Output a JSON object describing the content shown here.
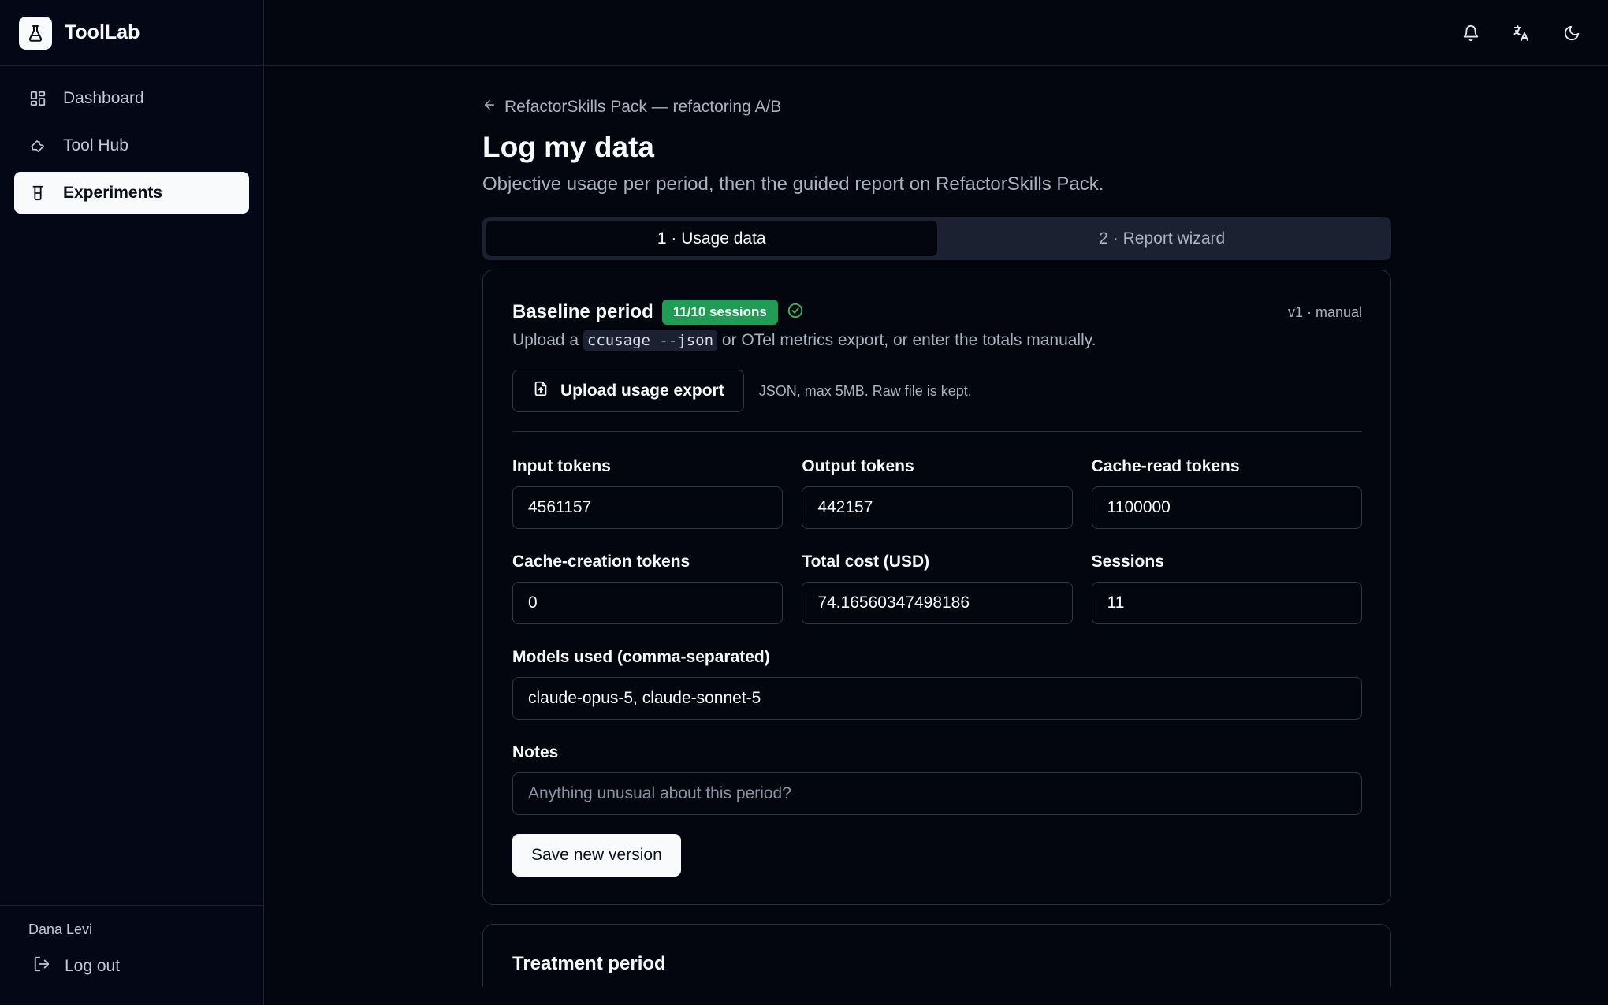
{
  "brand": {
    "name": "ToolLab"
  },
  "sidebar": {
    "items": [
      {
        "label": "Dashboard",
        "icon": "dashboard-icon",
        "active": false
      },
      {
        "label": "Tool Hub",
        "icon": "wrench-icon",
        "active": false
      },
      {
        "label": "Experiments",
        "icon": "beaker-icon",
        "active": true
      }
    ],
    "user_name": "Dana Levi",
    "logout_label": "Log out"
  },
  "topbar": {
    "icons": [
      "bell-icon",
      "translate-icon",
      "moon-icon"
    ]
  },
  "page": {
    "back_label": "RefactorSkills Pack — refactoring A/B",
    "title": "Log my data",
    "subtitle": "Objective usage per period, then the guided report on RefactorSkills Pack."
  },
  "tabs": [
    {
      "label": "1 · Usage data",
      "active": true
    },
    {
      "label": "2 · Report wizard",
      "active": false
    }
  ],
  "baseline": {
    "title": "Baseline period",
    "badge": "11/10 sessions",
    "badge_color": "#1f9d55",
    "version": "v1 · manual",
    "desc_pre": "Upload a",
    "desc_code": "ccusage --json",
    "desc_post": "or OTel metrics export, or enter the totals manually.",
    "upload_label": "Upload usage export",
    "upload_hint": "JSON, max 5MB. Raw file is kept.",
    "fields": {
      "input_tokens": {
        "label": "Input tokens",
        "value": "4561157"
      },
      "output_tokens": {
        "label": "Output tokens",
        "value": "442157"
      },
      "cache_read_tokens": {
        "label": "Cache-read tokens",
        "value": "1100000"
      },
      "cache_creation_tokens": {
        "label": "Cache-creation tokens",
        "value": "0"
      },
      "total_cost": {
        "label": "Total cost (USD)",
        "value": "74.16560347498186"
      },
      "sessions": {
        "label": "Sessions",
        "value": "11"
      }
    },
    "models": {
      "label": "Models used (comma-separated)",
      "value": "claude-opus-5, claude-sonnet-5"
    },
    "notes": {
      "label": "Notes",
      "placeholder": "Anything unusual about this period?"
    },
    "save_label": "Save new version"
  },
  "treatment": {
    "title": "Treatment period"
  }
}
